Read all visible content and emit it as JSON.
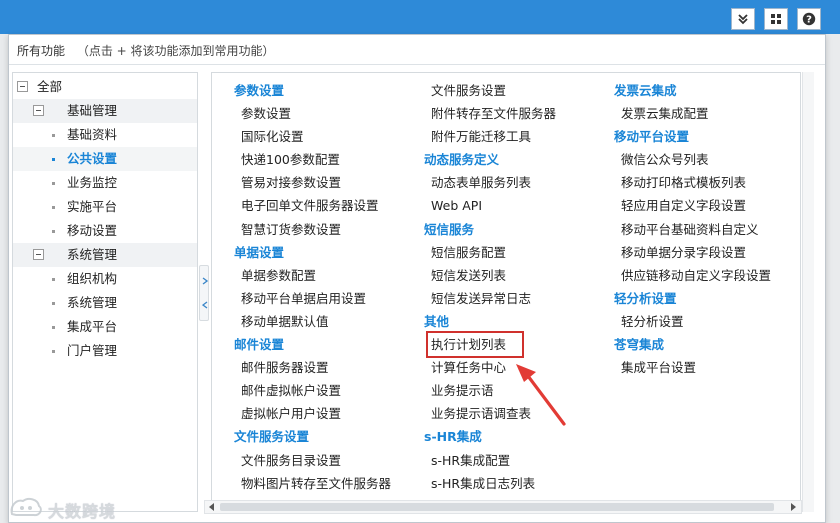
{
  "header": {
    "title": "所有功能",
    "hint": "（点击 + 将该功能添加到常用功能）"
  },
  "toolbar": {
    "icons": [
      "chevrons-down-icon",
      "grid-icon",
      "help-icon"
    ]
  },
  "tree": {
    "root": "全部",
    "groups": [
      {
        "label": "基础管理",
        "items": [
          "基础资料",
          "公共设置",
          "业务监控",
          "实施平台",
          "移动设置"
        ]
      },
      {
        "label": "系统管理",
        "items": [
          "组织机构",
          "系统管理",
          "集成平台",
          "门户管理"
        ]
      }
    ],
    "selected": "公共设置"
  },
  "columns": [
    [
      {
        "type": "head",
        "text": "参数设置"
      },
      {
        "type": "link",
        "text": "参数设置"
      },
      {
        "type": "link",
        "text": "国际化设置"
      },
      {
        "type": "link",
        "text": "快递100参数配置"
      },
      {
        "type": "link",
        "text": "管易对接参数设置"
      },
      {
        "type": "link",
        "text": "电子回单文件服务器设置"
      },
      {
        "type": "link",
        "text": "智慧订货参数设置"
      },
      {
        "type": "head",
        "text": "单据设置"
      },
      {
        "type": "link",
        "text": "单据参数配置"
      },
      {
        "type": "link",
        "text": "移动平台单据启用设置"
      },
      {
        "type": "link",
        "text": "移动单据默认值"
      },
      {
        "type": "head",
        "text": "邮件设置"
      },
      {
        "type": "link",
        "text": "邮件服务器设置"
      },
      {
        "type": "link",
        "text": "邮件虚拟帐户设置"
      },
      {
        "type": "link",
        "text": "虚拟帐户用户设置"
      },
      {
        "type": "head",
        "text": "文件服务设置"
      },
      {
        "type": "link",
        "text": "文件服务目录设置"
      },
      {
        "type": "link",
        "text": "物料图片转存至文件服务器"
      }
    ],
    [
      {
        "type": "link",
        "text": "文件服务设置"
      },
      {
        "type": "link",
        "text": "附件转存至文件服务器"
      },
      {
        "type": "link",
        "text": "附件万能迁移工具"
      },
      {
        "type": "head",
        "text": "动态服务定义"
      },
      {
        "type": "link",
        "text": "动态表单服务列表"
      },
      {
        "type": "link",
        "text": "Web API"
      },
      {
        "type": "head",
        "text": "短信服务"
      },
      {
        "type": "link",
        "text": "短信服务配置"
      },
      {
        "type": "link",
        "text": "短信发送列表"
      },
      {
        "type": "link",
        "text": "短信发送异常日志"
      },
      {
        "type": "head",
        "text": "其他"
      },
      {
        "type": "link",
        "text": "执行计划列表",
        "highlighted": true
      },
      {
        "type": "link",
        "text": "计算任务中心"
      },
      {
        "type": "link",
        "text": "业务提示语"
      },
      {
        "type": "link",
        "text": "业务提示语调查表"
      },
      {
        "type": "head",
        "text": "s-HR集成"
      },
      {
        "type": "link",
        "text": "s-HR集成配置"
      },
      {
        "type": "link",
        "text": "s-HR集成日志列表"
      }
    ],
    [
      {
        "type": "head",
        "text": "发票云集成"
      },
      {
        "type": "link",
        "text": "发票云集成配置"
      },
      {
        "type": "head",
        "text": "移动平台设置"
      },
      {
        "type": "link",
        "text": "微信公众号列表"
      },
      {
        "type": "link",
        "text": "移动打印格式模板列表"
      },
      {
        "type": "link",
        "text": "轻应用自定义字段设置"
      },
      {
        "type": "link",
        "text": "移动平台基础资料自定义"
      },
      {
        "type": "link",
        "text": "移动单据分录字段设置"
      },
      {
        "type": "link",
        "text": "供应链移动自定义字段设置"
      },
      {
        "type": "head",
        "text": "轻分析设置"
      },
      {
        "type": "link",
        "text": "轻分析设置"
      },
      {
        "type": "head",
        "text": "苍穹集成"
      },
      {
        "type": "link",
        "text": "集成平台设置"
      }
    ]
  ],
  "watermark": {
    "text": "大数跨境"
  },
  "colors": {
    "topbar": "#2e8ad8",
    "accent": "#1a85d6",
    "highlight": "#d0312d"
  }
}
